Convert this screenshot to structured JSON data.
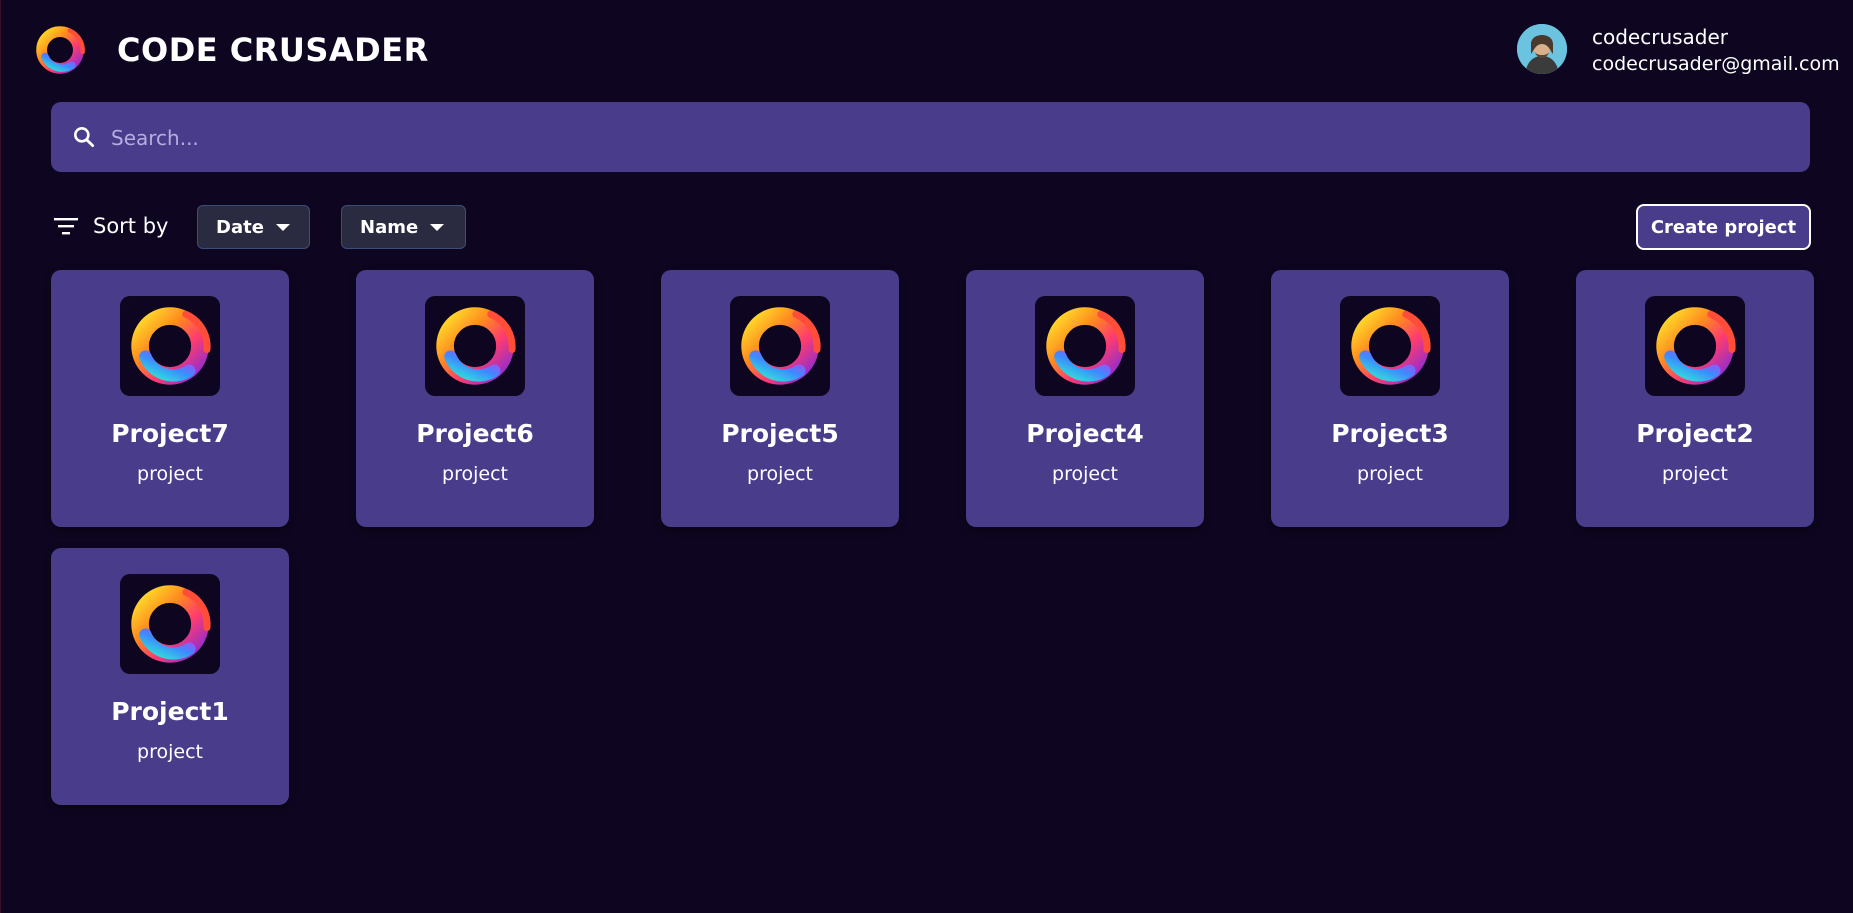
{
  "app": {
    "brand": "CODE CRUSADER"
  },
  "user": {
    "name": "codecrusader",
    "email": "codecrusader@gmail.com"
  },
  "search": {
    "placeholder": "Search..."
  },
  "sort": {
    "label": "Sort by",
    "options": [
      "Date",
      "Name"
    ]
  },
  "actions": {
    "create_project": "Create project"
  },
  "projects": [
    {
      "name": "Project7",
      "type": "project"
    },
    {
      "name": "Project6",
      "type": "project"
    },
    {
      "name": "Project5",
      "type": "project"
    },
    {
      "name": "Project4",
      "type": "project"
    },
    {
      "name": "Project3",
      "type": "project"
    },
    {
      "name": "Project2",
      "type": "project"
    },
    {
      "name": "Project1",
      "type": "project"
    }
  ],
  "colors": {
    "background": "#0e0621",
    "card": "#483c8b",
    "search": "#483c8b",
    "dropdown": "#2a2a40"
  },
  "icons": {
    "logo": "code-crusader-logo",
    "search": "search-icon",
    "sort": "filter-list-icon",
    "caret": "caret-down-icon"
  }
}
